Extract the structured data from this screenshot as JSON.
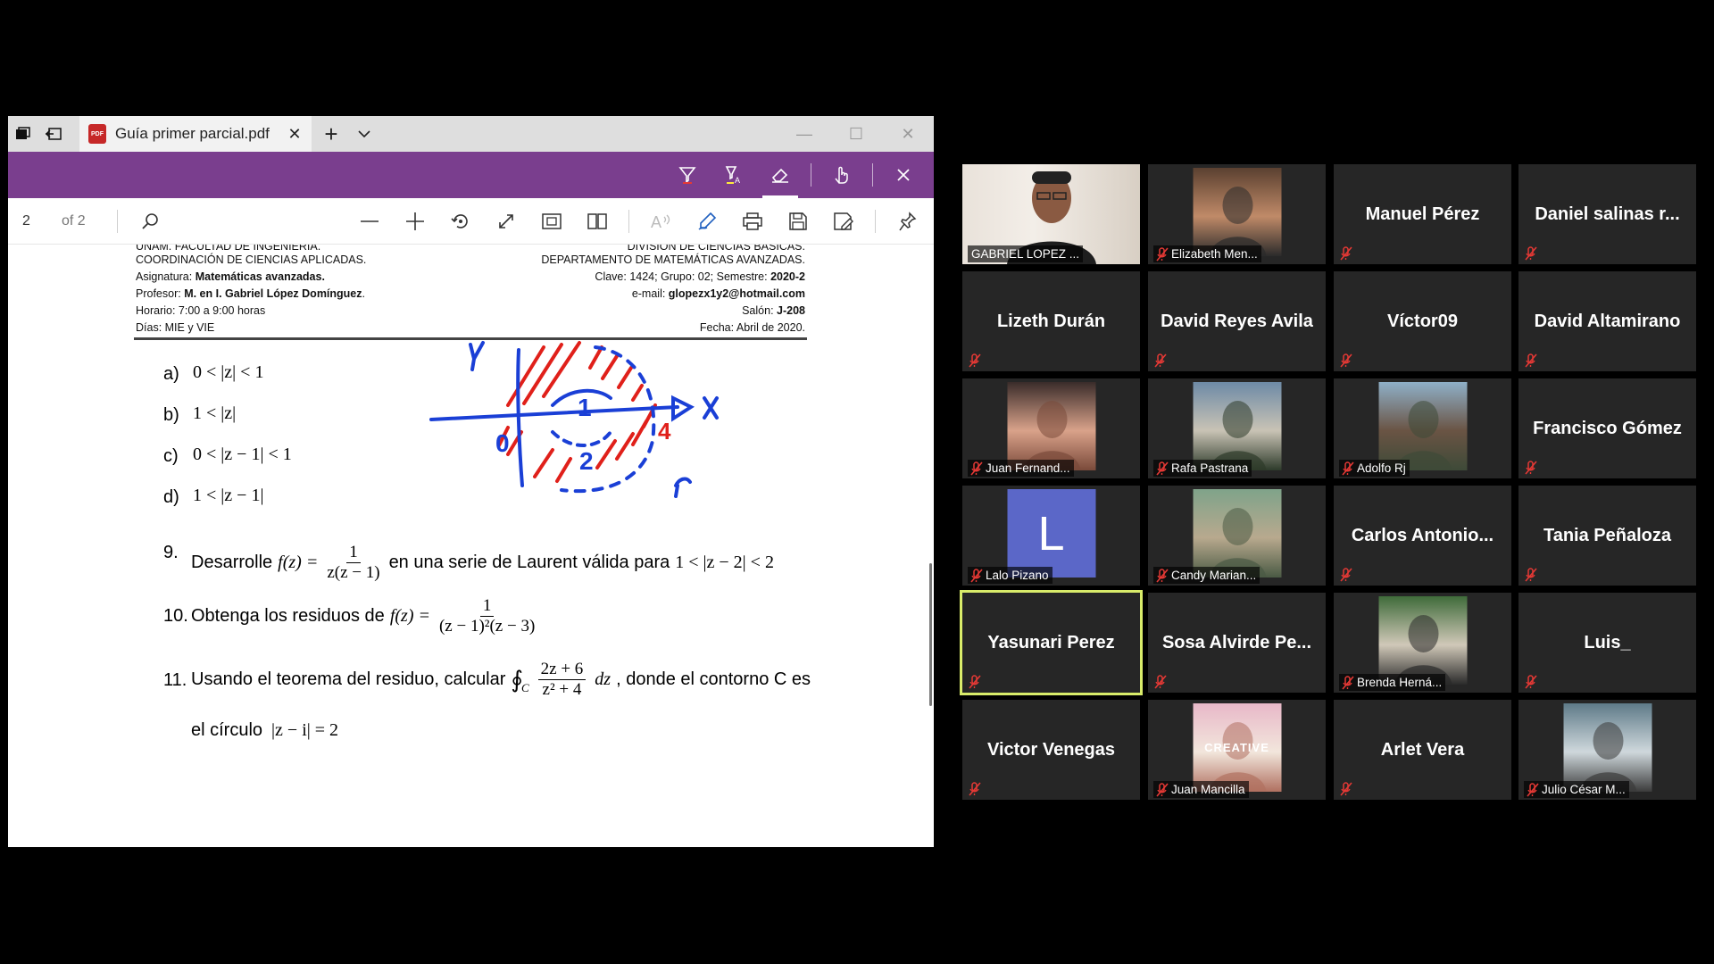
{
  "edge": {
    "tab_title": "Guía primer parcial.pdf",
    "page_current": "2",
    "page_total": "of 2"
  },
  "document": {
    "header_rows": [
      {
        "left_label": "UNAM. FACULTAD DE INGENIERÍA.",
        "left_value": "",
        "right_label": "DIVISIÓN DE CIENCIAS BÁSICAS.",
        "right_value": ""
      },
      {
        "left_label": "COORDINACIÓN DE CIENCIAS APLICADAS.",
        "left_value": "",
        "right_label": "DEPARTAMENTO DE MATEMÁTICAS AVANZADAS.",
        "right_value": ""
      },
      {
        "left_label": "Asignatura: ",
        "left_value": "Matemáticas avanzadas.",
        "right_label": "Clave: 1424; Grupo: 02; Semestre: ",
        "right_value": "2020-2"
      },
      {
        "left_label": "Profesor: ",
        "left_value": "M. en I. Gabriel López Domínguez",
        "right_label": "e-mail: ",
        "right_value": "glopezx1y2@hotmail.com"
      },
      {
        "left_label": "Horario: 7:00 a 9:00 horas",
        "left_value": "",
        "right_label": "Salón: ",
        "right_value": "J-208"
      },
      {
        "left_label": "Días: MIE y VIE",
        "left_value": "",
        "right_label": "Fecha: Abril de 2020.",
        "right_value": ""
      }
    ],
    "items": [
      {
        "label": "a)",
        "expr": "0 < |z| < 1"
      },
      {
        "label": "b)",
        "expr": "1 < |z|"
      },
      {
        "label": "c)",
        "expr": "0 < |z − 1| < 1"
      },
      {
        "label": "d)",
        "expr": "1 < |z − 1|"
      }
    ],
    "q9": {
      "num": "9.",
      "text1": "Desarrolle",
      "fx": "f(z) =",
      "num_frac": "1",
      "den_frac": "z(z − 1)",
      "text2": "en una serie de Laurent válida para",
      "cond": "1 < |z − 2| < 2"
    },
    "q10": {
      "num": "10.",
      "text1": "Obtenga los residuos de",
      "fx": "f(z) =",
      "num_frac": "1",
      "den_frac": "(z − 1)²(z − 3)"
    },
    "q11": {
      "num": "11.",
      "text1": "Usando el teorema del residuo, calcular",
      "integral": "∮",
      "sub": "C",
      "num_frac": "2z + 6",
      "den_frac": "z² + 4",
      "dz": "dz",
      "text2": ", donde el contorno C es",
      "line2": "el círculo",
      "cond": "|z − i| = 2"
    },
    "sketch_labels": {
      "y_axis": "y",
      "x_axis": "x",
      "origin": "0",
      "region1": "1",
      "region2": "2",
      "point": "4",
      "r": "r"
    }
  },
  "participants": [
    {
      "name": "GABRIEL LOPEZ ...",
      "type": "video"
    },
    {
      "name": "Elizabeth Men...",
      "type": "photo"
    },
    {
      "name": "Manuel Pérez",
      "type": "name"
    },
    {
      "name": "Daniel salinas r...",
      "type": "name"
    },
    {
      "name": "Lizeth Durán",
      "type": "name"
    },
    {
      "name": "David Reyes Avila",
      "type": "name"
    },
    {
      "name": "Víctor09",
      "type": "name"
    },
    {
      "name": "David Altamirano",
      "type": "name"
    },
    {
      "name": "Juan Fernand...",
      "type": "photo"
    },
    {
      "name": "Rafa Pastrana",
      "type": "photo"
    },
    {
      "name": "Adolfo Rj",
      "type": "photo"
    },
    {
      "name": "Francisco Gómez",
      "type": "name"
    },
    {
      "name": "Lalo Pizano",
      "type": "avatar",
      "initial": "L"
    },
    {
      "name": "Candy Marian...",
      "type": "photo"
    },
    {
      "name": "Carlos Antonio...",
      "type": "name"
    },
    {
      "name": "Tania Peñaloza",
      "type": "name"
    },
    {
      "name": "Yasunari Perez",
      "type": "name",
      "highlight": true
    },
    {
      "name": "Sosa Alvirde Pe...",
      "type": "name"
    },
    {
      "name": "Brenda Herná...",
      "type": "photo"
    },
    {
      "name": "Luis_",
      "type": "name"
    },
    {
      "name": "Victor Venegas",
      "type": "name"
    },
    {
      "name": "Juan Mancilla",
      "type": "photo",
      "overlay_text": "CREATIVE"
    },
    {
      "name": "Arlet Vera",
      "type": "name"
    },
    {
      "name": "Julio César M...",
      "type": "photo"
    }
  ],
  "colors": {
    "ink_bar": "#7a3e8e",
    "active_speaker": "#d9ec6a",
    "tile_bg": "#262626",
    "muted_icon": "#e53935"
  }
}
